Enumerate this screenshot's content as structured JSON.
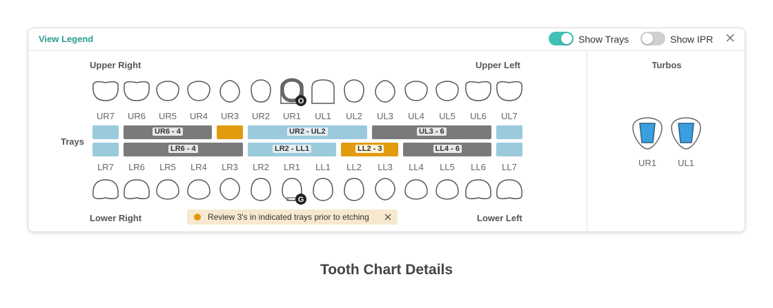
{
  "header": {
    "view_legend": "View Legend",
    "show_trays_label": "Show Trays",
    "show_trays_on": true,
    "show_ipr_label": "Show IPR",
    "show_ipr_on": false
  },
  "quadrants": {
    "upper_right": "Upper Right",
    "upper_left": "Upper Left",
    "lower_right": "Lower Right",
    "lower_left": "Lower Left"
  },
  "trays_label": "Trays",
  "upper_teeth": [
    "UR7",
    "UR6",
    "UR5",
    "UR4",
    "UR3",
    "UR2",
    "UR1",
    "UL1",
    "UL2",
    "UL3",
    "UL4",
    "UL5",
    "UL6",
    "UL7"
  ],
  "lower_teeth": [
    "LR7",
    "LR6",
    "LR5",
    "LR4",
    "LR3",
    "LR2",
    "LR1",
    "LL1",
    "LL2",
    "LL3",
    "LL4",
    "LL5",
    "LL6",
    "LL7"
  ],
  "upper_trays": [
    {
      "label": "",
      "color": "blue",
      "from": 0,
      "to": 0
    },
    {
      "label": "UR6 - 4",
      "color": "gray",
      "from": 1,
      "to": 3
    },
    {
      "label": "",
      "color": "orange",
      "from": 4,
      "to": 4
    },
    {
      "label": "UR2 - UL2",
      "color": "blue",
      "from": 5,
      "to": 8
    },
    {
      "label": "UL3 - 6",
      "color": "gray",
      "from": 9,
      "to": 12
    },
    {
      "label": "",
      "color": "blue",
      "from": 13,
      "to": 13
    }
  ],
  "lower_trays": [
    {
      "label": "",
      "color": "blue",
      "from": 0,
      "to": 0
    },
    {
      "label": "LR6 - 4",
      "color": "gray",
      "from": 1,
      "to": 4
    },
    {
      "label": "LR2 - LL1",
      "color": "blue",
      "from": 5,
      "to": 7
    },
    {
      "label": "LL2 - 3",
      "color": "orange",
      "from": 8,
      "to": 9
    },
    {
      "label": "LL4 - 6",
      "color": "gray",
      "from": 10,
      "to": 12
    },
    {
      "label": "",
      "color": "blue",
      "from": 13,
      "to": 13
    }
  ],
  "badges": {
    "upper": "O",
    "lower": "G"
  },
  "notice": {
    "text": "Review 3's in indicated trays prior to etching"
  },
  "turbos": {
    "title": "Turbos",
    "teeth": [
      "UR1",
      "UL1"
    ]
  },
  "page_title": "Tooth Chart Details",
  "colors": {
    "accent": "#2a9d8f",
    "tray_blue": "#9bcadd",
    "tray_gray": "#7a7a7a",
    "tray_orange": "#e29a0e",
    "turbo_blue": "#3a9fe0"
  }
}
